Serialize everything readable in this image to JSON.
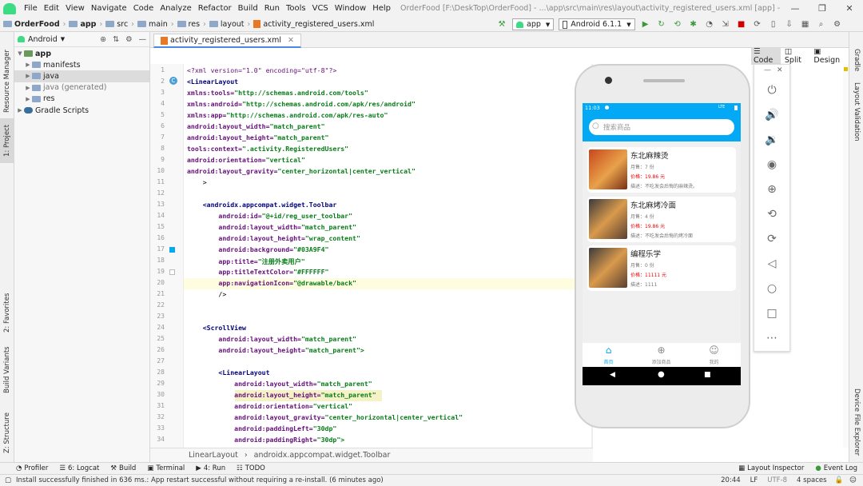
{
  "menubar": {
    "items": [
      "File",
      "Edit",
      "View",
      "Navigate",
      "Code",
      "Analyze",
      "Refactor",
      "Build",
      "Run",
      "Tools",
      "VCS",
      "Window",
      "Help"
    ],
    "window_title": "OrderFood [F:\\DeskTop\\OrderFood] - ...\\app\\src\\main\\res\\layout\\activity_registered_users.xml [app] - Android Studio"
  },
  "breadcrumb": [
    "OrderFood",
    "app",
    "src",
    "main",
    "res",
    "layout",
    "activity_registered_users.xml"
  ],
  "toolbar": {
    "run_config": "app",
    "device": "Android 6.1.1"
  },
  "project_panel": {
    "view_mode": "Android",
    "tree": [
      {
        "label": "app",
        "level": 0,
        "expanded": true,
        "kind": "module"
      },
      {
        "label": "manifests",
        "level": 1,
        "expanded": false,
        "kind": "folder"
      },
      {
        "label": "java",
        "level": 1,
        "expanded": false,
        "kind": "folder",
        "selected": true
      },
      {
        "label": "java (generated)",
        "level": 1,
        "expanded": false,
        "kind": "folder"
      },
      {
        "label": "res",
        "level": 1,
        "expanded": false,
        "kind": "folder"
      },
      {
        "label": "Gradle Scripts",
        "level": 0,
        "expanded": false,
        "kind": "gradle"
      }
    ]
  },
  "left_tool_tabs": [
    "Resource Manager",
    "1: Project",
    "2: Favorites",
    "Build Variants",
    "Z: Structure"
  ],
  "right_tool_tabs": [
    "Gradle",
    "Layout Validation",
    "Device File Explorer"
  ],
  "editor_tab": "activity_registered_users.xml",
  "view_modes": [
    "Code",
    "Split",
    "Design"
  ],
  "code_lines": [
    [
      {
        "t": "<?xml version=\"1.0\" encoding=\"utf-8\"?>",
        "c": "nsp"
      }
    ],
    [
      {
        "t": "<LinearLayout",
        "c": "tag"
      }
    ],
    [
      {
        "t": "xmlns:tools=",
        "c": "attr"
      },
      {
        "t": "\"http://schemas.android.com/tools\"",
        "c": "val"
      }
    ],
    [
      {
        "t": "xmlns:android=",
        "c": "attr"
      },
      {
        "t": "\"http://schemas.android.com/apk/res/android\"",
        "c": "val"
      }
    ],
    [
      {
        "t": "xmlns:app=",
        "c": "attr"
      },
      {
        "t": "\"http://schemas.android.com/apk/res-auto\"",
        "c": "val"
      }
    ],
    [
      {
        "t": "android:layout_width=",
        "c": "attr"
      },
      {
        "t": "\"match_parent\"",
        "c": "val"
      }
    ],
    [
      {
        "t": "android:layout_height=",
        "c": "attr"
      },
      {
        "t": "\"match_parent\"",
        "c": "val"
      }
    ],
    [
      {
        "t": "tools:context=",
        "c": "attr"
      },
      {
        "t": "\".activity.RegisteredUsers\"",
        "c": "val"
      }
    ],
    [
      {
        "t": "android:orientation=",
        "c": "attr"
      },
      {
        "t": "\"vertical\"",
        "c": "val"
      }
    ],
    [
      {
        "t": "android:layout_gravity=",
        "c": "attr"
      },
      {
        "t": "\"center_horizontal|center_vertical\"",
        "c": "val"
      }
    ],
    [
      {
        "t": "    >",
        "c": ""
      }
    ],
    [],
    [
      {
        "t": "    <androidx.appcompat.widget.Toolbar",
        "c": "tag"
      }
    ],
    [
      {
        "t": "        android:id=",
        "c": "attr"
      },
      {
        "t": "\"@+id/reg_user_toolbar\"",
        "c": "val"
      }
    ],
    [
      {
        "t": "        android:layout_width=",
        "c": "attr"
      },
      {
        "t": "\"match_parent\"",
        "c": "val"
      }
    ],
    [
      {
        "t": "        android:layout_height=",
        "c": "attr"
      },
      {
        "t": "\"wrap_content\"",
        "c": "val"
      }
    ],
    [
      {
        "t": "        android:background=",
        "c": "attr"
      },
      {
        "t": "\"#03A9F4\"",
        "c": "val"
      }
    ],
    [
      {
        "t": "        app:title=",
        "c": "attr"
      },
      {
        "t": "\"注册外卖用户\"",
        "c": "val"
      }
    ],
    [
      {
        "t": "        app:titleTextColor=",
        "c": "attr"
      },
      {
        "t": "\"#FFFFFF\"",
        "c": "val"
      }
    ],
    [
      {
        "t": "        app:navigationIcon=",
        "c": "attr"
      },
      {
        "t": "\"@drawable/back\"",
        "c": "val"
      }
    ],
    [
      {
        "t": "        />",
        "c": ""
      }
    ],
    [],
    [],
    [
      {
        "t": "    <ScrollView",
        "c": "tag"
      }
    ],
    [
      {
        "t": "        android:layout_width=",
        "c": "attr"
      },
      {
        "t": "\"match_parent\"",
        "c": "val"
      }
    ],
    [
      {
        "t": "        android:layout_height=",
        "c": "attr"
      },
      {
        "t": "\"match_parent\">",
        "c": "val"
      }
    ],
    [],
    [
      {
        "t": "        <LinearLayout",
        "c": "tag"
      }
    ],
    [
      {
        "t": "            android:layout_width=",
        "c": "attr"
      },
      {
        "t": "\"match_parent\"",
        "c": "val"
      }
    ],
    [
      {
        "t": "            android:layout_height=",
        "c": "attr"
      },
      {
        "t": "\"match_parent\"",
        "c": "val"
      }
    ],
    [
      {
        "t": "            android:orientation=",
        "c": "attr"
      },
      {
        "t": "\"vertical\"",
        "c": "val"
      }
    ],
    [
      {
        "t": "            android:layout_gravity=",
        "c": "attr"
      },
      {
        "t": "\"center_horizontal|center_vertical\"",
        "c": "val"
      }
    ],
    [
      {
        "t": "            android:paddingLeft=",
        "c": "attr"
      },
      {
        "t": "\"30dp\"",
        "c": "val"
      }
    ],
    [
      {
        "t": "            android:paddingRight=",
        "c": "attr"
      },
      {
        "t": "\"30dp\">",
        "c": "val"
      }
    ]
  ],
  "editor_breadcrumb": [
    "LinearLayout",
    "androidx.appcompat.widget.Toolbar"
  ],
  "phone": {
    "time": "11:03",
    "signal": "LTE",
    "search_placeholder": "搜索商品",
    "foods": [
      {
        "name": "东北麻辣烫",
        "sales": "月售：7 份",
        "price": "价格：19.86 元",
        "desc": "描述：不吃发会后悔的麻辣烫。"
      },
      {
        "name": "东北麻烤冷面",
        "sales": "月售：4 份",
        "price": "价格：19.86 元",
        "desc": "描述：不吃发会后悔的烤冷面"
      },
      {
        "name": "编程乐学",
        "sales": "月售：0 份",
        "price": "价格：11111 元",
        "desc": "描述：1111"
      }
    ],
    "nav": [
      "首页",
      "添加商品",
      "我的"
    ]
  },
  "bottom_tools": [
    "Profiler",
    "6: Logcat",
    "Build",
    "Terminal",
    "4: Run",
    "TODO"
  ],
  "bottom_tools_right": [
    "Layout Inspector",
    "Event Log"
  ],
  "status": {
    "message": "Install successfully finished in 636 ms.: App restart successful without requiring a re-install. (6 minutes ago)",
    "position": "20:44",
    "line_sep": "LF",
    "encoding": "UTF-8",
    "indent": "4 spaces"
  },
  "colors": {
    "accent": "#4a88e2",
    "phone_toolbar": "#03A9F4",
    "price": "#e00000"
  }
}
